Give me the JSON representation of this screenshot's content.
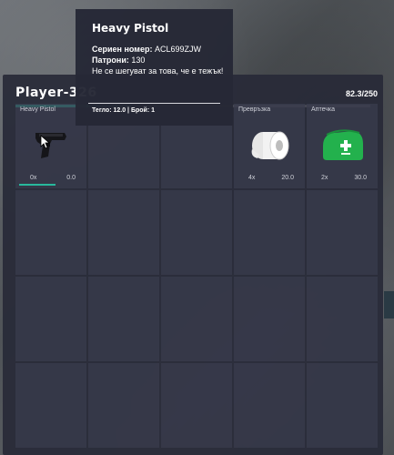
{
  "player": {
    "name": "Player-326",
    "weight": "82.3/250",
    "weight_fraction": 0.33
  },
  "tooltip": {
    "title": "Heavy Pistol",
    "serial_label": "Сериен номер:",
    "serial_value": "ACL699ZJW",
    "ammo_label": "Патрони:",
    "ammo_value": "130",
    "description": "Не се шегуват за това, че е тежък!",
    "footer": "Тегло: 12.0 | Брой: 1"
  },
  "slots": [
    {
      "label": "Heavy Pistol",
      "count": "0x",
      "weight": "0.0",
      "icon": "pistol-icon",
      "durability": 1.0
    },
    {
      "label": "Превръзка",
      "count": "4x",
      "weight": "20.0",
      "icon": "bandage-icon"
    },
    {
      "label": "Аптечка",
      "count": "2x",
      "weight": "30.0",
      "icon": "medkit-icon"
    }
  ],
  "colors": {
    "accent": "#28b89c",
    "panel": "#282a38",
    "slot": "#3a3c4e",
    "medkit": "#23b14d"
  }
}
